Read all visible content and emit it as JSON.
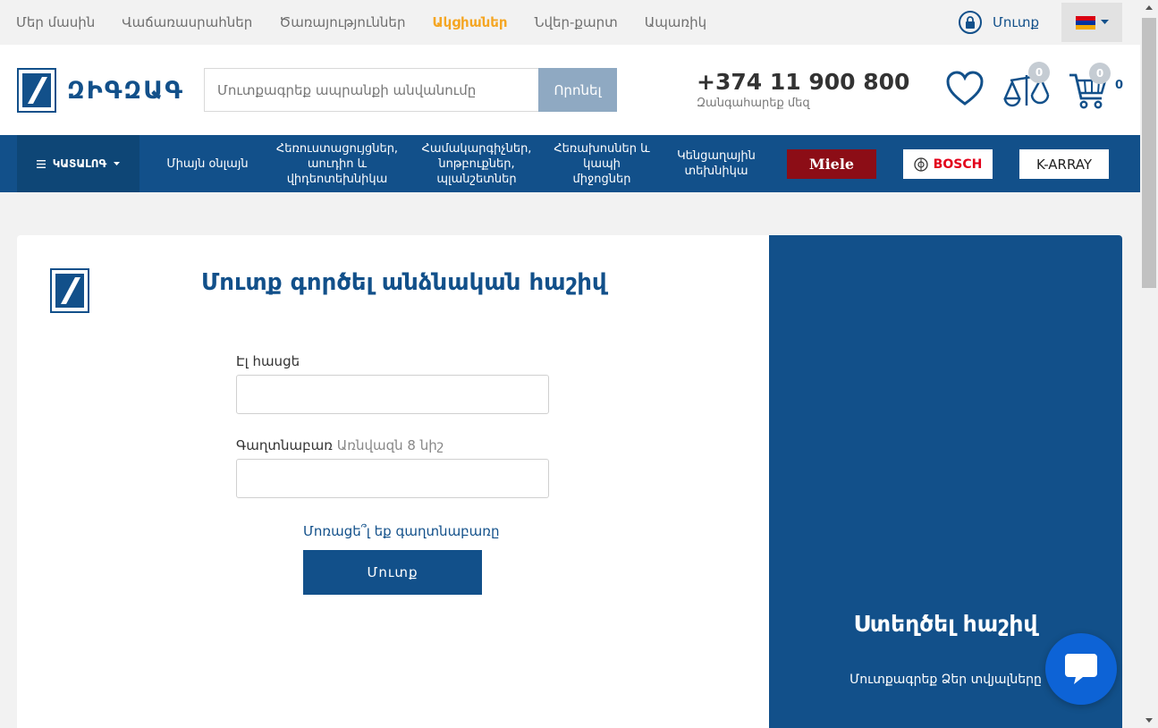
{
  "top_nav": {
    "items": [
      {
        "label": "Մեր մասին"
      },
      {
        "label": "Վաճառասրահներ"
      },
      {
        "label": "Ծառայություններ"
      },
      {
        "label": "Ակցիաներ"
      },
      {
        "label": "Նվեր-քարտ"
      },
      {
        "label": "Ապառիկ"
      }
    ],
    "login_label": "Մուտք"
  },
  "header": {
    "logo_text": "ԶԻԳԶԱԳ",
    "search_placeholder": "Մուտքագրեք ապրանքի անվանումը",
    "search_button": "Որոնել",
    "phone": "+374 11 900 800",
    "phone_sub": "Զանգահարեք մեզ",
    "compare_count": "0",
    "cart_badge": "0",
    "cart_count": "0"
  },
  "nav": {
    "catalog": "ԿԱՏԱԼՈԳ",
    "items": [
      {
        "label": "Միայն օնլայն"
      },
      {
        "label": "Հեռուստացույցներ, աուդիո և վիդեոտեխնիկա"
      },
      {
        "label": "Համակարգիչներ, նոթբուքներ, պլանշետներ"
      },
      {
        "label": "Հեռախոսներ և կապի միջոցներ"
      },
      {
        "label": "Կենցաղային տեխնիկա"
      }
    ],
    "brands": [
      "Miele",
      "BOSCH",
      "K-ARRAY"
    ]
  },
  "login_form": {
    "title": "Մուտք գործել անձնական հաշիվ",
    "email_label": "Էլ հասցե",
    "password_label": "Գաղտնաբառ",
    "password_hint": "Առնվազն 8 նիշ",
    "forgot_link": "Մոռացե՞լ եք գաղտնաբառը",
    "submit": "Մուտք"
  },
  "register_panel": {
    "title": "Ստեղծել հաշիվ",
    "subtitle": "Մուտքագրեք Ձեր տվյալները"
  },
  "colors": {
    "brand_blue": "#12508a",
    "promo_orange": "#f5a623",
    "chat_blue": "#0d63d6"
  }
}
